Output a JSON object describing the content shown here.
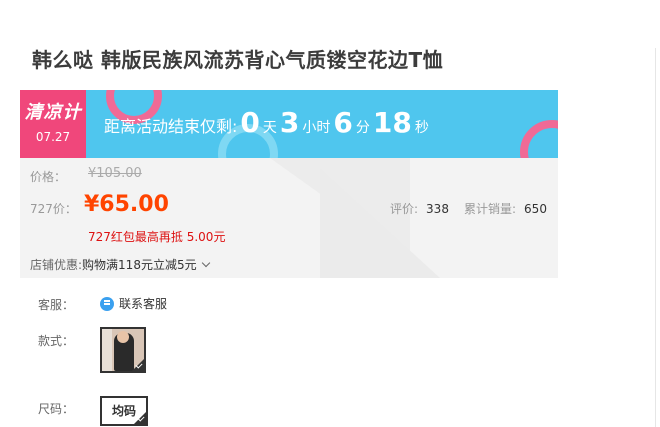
{
  "product": {
    "title": "韩么哒 韩版民族风流苏背心气质镂空花边T恤"
  },
  "promo_banner": {
    "badge_title": "清凉计",
    "badge_date": "07.27",
    "countdown_prefix": "距离活动结束仅剩:",
    "days": "0",
    "days_unit": "天",
    "hours": "3",
    "hours_unit": "小时",
    "minutes": "6",
    "minutes_unit": "分",
    "seconds": "18",
    "seconds_unit": "秒",
    "colors": {
      "banner_bg": "#4fc6ee",
      "badge_bg": "#f0477b"
    }
  },
  "pricing": {
    "price_label": "价格：",
    "original_price": "¥105.00",
    "sale_label": "727价：",
    "sale_price": "¥65.00",
    "red_packet_note": "727红包最高再抵 5.00元",
    "rating_label": "评价:",
    "rating_count": "338",
    "sales_label": "累计销量:",
    "sales_count": "650",
    "shop_promo_label": "店铺优惠:",
    "shop_promo_value": "购物满118元立减5元",
    "colors": {
      "sale_price": "#ff4400"
    }
  },
  "options": {
    "service_label": "客服：",
    "service_link": "联系客服",
    "style_label": "款式：",
    "size_label": "尺码：",
    "size_value": "均码"
  }
}
